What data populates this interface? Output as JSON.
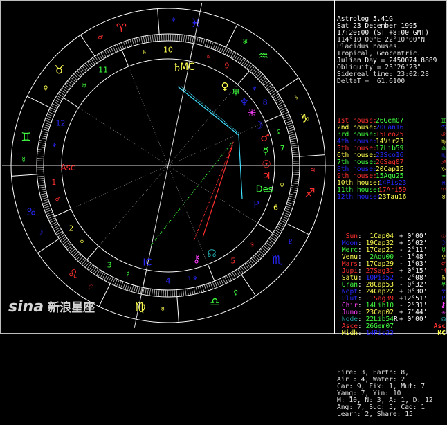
{
  "header": [
    "Astrolog 5.41G",
    "Sat 23 December 1995",
    "17:20:00 (ST +8:00 GMT)",
    "114°10'00\"E 22°10'00\"N",
    "Placidus houses.",
    "Tropical, Geocentric.",
    "Julian Day = 2450074.8889",
    "Obliquity = 23°26'23\"",
    "Sidereal time: 23:02:28",
    "DeltaT =  61.6100"
  ],
  "houses": [
    {
      "label": "1st house:",
      "value": "26Gem07",
      "glyph": "♊",
      "lc": "r",
      "vc": "g"
    },
    {
      "label": "2nd house:",
      "value": "20Can16",
      "glyph": "♋",
      "lc": "y",
      "vc": "b"
    },
    {
      "label": "3rd house:",
      "value": "15Leo25",
      "glyph": "♌",
      "lc": "g",
      "vc": "r"
    },
    {
      "label": "4th house:",
      "value": "14Vir23",
      "glyph": "♍",
      "lc": "b",
      "vc": "y"
    },
    {
      "label": "5th house:",
      "value": "17Lib59",
      "glyph": "♎",
      "lc": "r",
      "vc": "g"
    },
    {
      "label": "6th house:",
      "value": "23Sco16",
      "glyph": "♏",
      "lc": "y",
      "vc": "b"
    },
    {
      "label": "7th house:",
      "value": "26Sag07",
      "glyph": "♐",
      "lc": "g",
      "vc": "r"
    },
    {
      "label": "8th house:",
      "value": "20Cap15",
      "glyph": "♑",
      "lc": "b",
      "vc": "y"
    },
    {
      "label": "9th house:",
      "value": "15Aqu25",
      "glyph": "♒",
      "lc": "r",
      "vc": "g"
    },
    {
      "label": "10th house:",
      "value": "14Pis23",
      "glyph": "♓",
      "lc": "y",
      "vc": "b"
    },
    {
      "label": "11th house:",
      "value": "17Ari59",
      "glyph": "♈",
      "lc": "g",
      "vc": "r"
    },
    {
      "label": "12th house:",
      "value": "23Tau16",
      "glyph": "♉",
      "lc": "b",
      "vc": "y"
    }
  ],
  "planets": [
    {
      "name": "Sun",
      "value": "1Cap04",
      "aspect": "+ 0°00'",
      "glyph": "☉",
      "lc": "r",
      "vc": "y"
    },
    {
      "name": "Moon",
      "value": "19Cap32",
      "aspect": "+ 5°02'",
      "glyph": "☽",
      "lc": "b",
      "vc": "y"
    },
    {
      "name": "Merc",
      "value": "17Cap21",
      "aspect": "- 2°11'",
      "glyph": "☿",
      "lc": "g",
      "vc": "y"
    },
    {
      "name": "Venu",
      "value": "2Aqu00",
      "aspect": "- 1°48'",
      "glyph": "♀",
      "lc": "y",
      "vc": "g"
    },
    {
      "name": "Mars",
      "value": "17Cap29",
      "aspect": "- 1°03'",
      "glyph": "♂",
      "lc": "r",
      "vc": "y"
    },
    {
      "name": "Jupi",
      "value": "27Sag31",
      "aspect": "+ 0°15'",
      "glyph": "♃",
      "lc": "r",
      "vc": "r"
    },
    {
      "name": "Satu",
      "value": "10Pis52",
      "aspect": "- 2°08'",
      "glyph": "♄",
      "lc": "y",
      "vc": "b"
    },
    {
      "name": "Uran",
      "value": "28Cap53",
      "aspect": "- 0°32'",
      "glyph": "♅",
      "lc": "g",
      "vc": "y"
    },
    {
      "name": "Nept",
      "value": "24Cap22",
      "aspect": "+ 0°30'",
      "glyph": "♆",
      "lc": "b",
      "vc": "y"
    },
    {
      "name": "Plut",
      "value": "1Sag39",
      "aspect": "+12°51'",
      "glyph": "♇",
      "lc": "b",
      "vc": "r"
    },
    {
      "name": "Chir",
      "value": "14Lib10",
      "aspect": "- 2°31'",
      "glyph": "⚷",
      "lc": "m",
      "vc": "g"
    },
    {
      "name": "Juno",
      "value": "23Cap02",
      "aspect": "+ 7°44'",
      "glyph": "✳",
      "lc": "m",
      "vc": "y"
    },
    {
      "name": "Node",
      "value": "22Lib54",
      "retro": "R",
      "aspect": "+ 0°00'",
      "glyph": "☊",
      "lc": "t",
      "vc": "g"
    },
    {
      "name": "Asce",
      "value": "26Gem07",
      "aspect": "",
      "glyph": "Asc",
      "lc": "r",
      "vc": "g"
    },
    {
      "name": "Midh",
      "value": "14Pis23",
      "aspect": "",
      "glyph": "MC",
      "lc": "y",
      "vc": "b"
    }
  ],
  "summary": [
    "Fire: 3, Earth: 8,",
    "Air : 4, Water: 2",
    "Car: 9, Fix: 1, Mut: 7",
    "Yang: 7, Yin: 10",
    "M: 10, N: 3, A: 1, D: 12",
    "Ang: 7, Suc: 5, Cad: 1",
    "Learn: 2, Share: 15"
  ],
  "wheel": {
    "ascendant_lon": 86.12,
    "house_cusps": [
      86.12,
      110.27,
      135.42,
      164.38,
      197.98,
      233.27,
      266.12,
      290.27,
      315.42,
      344.38,
      17.98,
      53.27
    ],
    "house_numbers": [
      "1",
      "2",
      "3",
      "4",
      "5",
      "6",
      "7",
      "8",
      "9",
      "10",
      "11",
      "12"
    ],
    "signs": [
      "♈",
      "♉",
      "♊",
      "♋",
      "♌",
      "♍",
      "♎",
      "♏",
      "♐",
      "♑",
      "♒",
      "♓"
    ],
    "sign_rulers": [
      "♂",
      "♀",
      "☿",
      "☽",
      "☉",
      "☿",
      "♀",
      "♇",
      "♃",
      "♄",
      "♅",
      "♆"
    ],
    "house_rulers": [
      "♂",
      "♀",
      "☿",
      "☽ ♆",
      "☉",
      "♀",
      "♀",
      "♆",
      "♃",
      "♄",
      "♅",
      "♆"
    ],
    "axis_labels": {
      "asc": "Asc",
      "mc": "MC",
      "des": "Des",
      "ic": "IC"
    },
    "colors": {
      "fire": "#ff3030",
      "earth": "#ffff50",
      "air": "#40ff40",
      "water": "#2828ff",
      "aspect_square": "#ff3030",
      "aspect_trine": "#40ff40",
      "aspect_opposition": "#40e0ff",
      "ring": "#ffffff"
    }
  },
  "logo": {
    "latin": "sina",
    "chinese": "新浪星座"
  }
}
